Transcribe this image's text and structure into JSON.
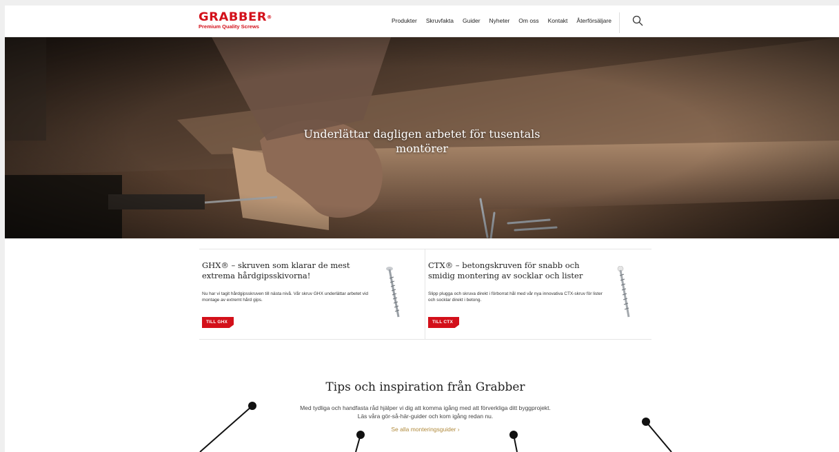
{
  "header": {
    "logo_main": "GRABBER",
    "logo_reg": "®",
    "logo_sub": "Premium Quality Screws",
    "nav": [
      "Produkter",
      "Skruvfakta",
      "Guider",
      "Nyheter",
      "Om oss",
      "Kontakt",
      "Återförsäljare"
    ]
  },
  "hero": {
    "title": "Underlättar dagligen arbetet för tusentals montörer"
  },
  "cards": [
    {
      "title": "GHX® – skruven som klarar de mest extrema hårdgipsskivorna!",
      "text": "Nu har vi tagit hårdgipsskruven till nästa nivå. Vår skruv GHX underlättar arbetet vid montage av extremt hård gips.",
      "button": "TILL GHX"
    },
    {
      "title": "CTX® – betongskruven för snabb och smidig montering av socklar och lister",
      "text": "Slipp plugga och skruva direkt i förborrat hål med vår nya innovativa CTX-skruv för lister och socklar direkt i betong.",
      "button": "TILL CTX"
    }
  ],
  "tips": {
    "title": "Tips och inspiration från Grabber",
    "text_line1": "Med tydliga och handfasta råd hjälper vi dig att komma igång med att förverkliga ditt byggprojekt.",
    "text_line2": "Läs våra gör-så-här-guider och kom igång redan nu.",
    "link": "Se alla monteringsguider ›"
  },
  "colors": {
    "brand_red": "#d3101a",
    "link_gold": "#b08a3c"
  }
}
